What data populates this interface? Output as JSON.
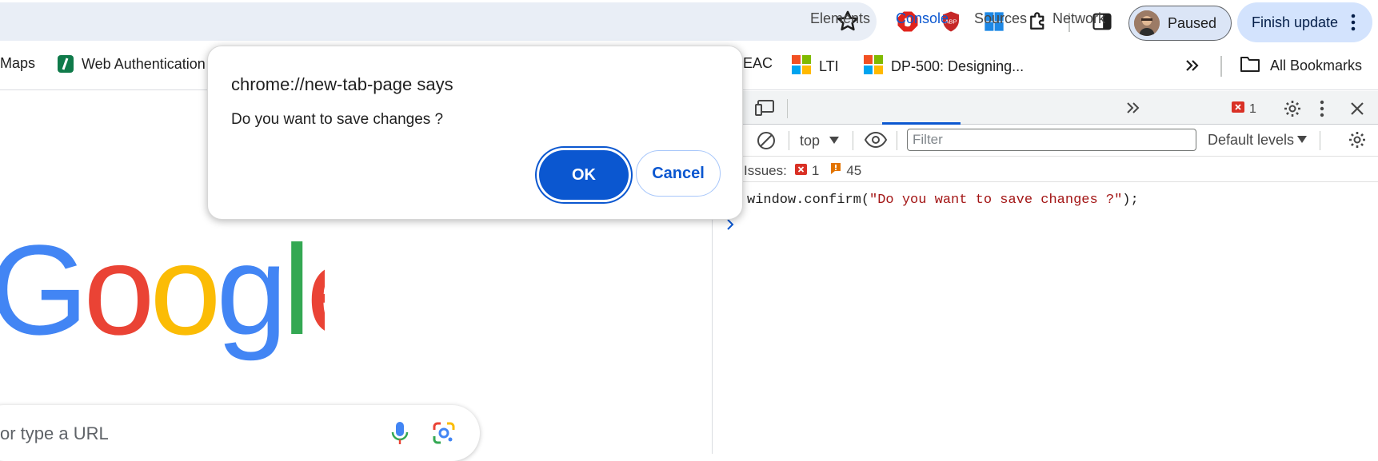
{
  "toolbar": {
    "profile_label": "Paused",
    "update_label": "Finish update"
  },
  "bookmarks": [
    {
      "label": "Maps"
    },
    {
      "label": "Web Authentication"
    },
    {
      "label": "EAC"
    },
    {
      "label": "LTI"
    },
    {
      "label": "DP-500: Designing..."
    }
  ],
  "all_bookmarks_label": "All Bookmarks",
  "page": {
    "logo_text": "Google",
    "search_placeholder": "or type a URL"
  },
  "dialog": {
    "title": "chrome://new-tab-page says",
    "message": "Do you want to save changes ?",
    "ok_label": "OK",
    "cancel_label": "Cancel"
  },
  "devtools": {
    "tabs": [
      "Elements",
      "Console",
      "Sources",
      "Network"
    ],
    "active_tab": "Console",
    "error_count": "1",
    "context": "top",
    "filter_placeholder": "Filter",
    "levels": "Default levels",
    "issues_label": "Issues:",
    "issues_errors": "1",
    "issues_warnings": "45",
    "console_code_prefix": "window.confirm(",
    "console_code_string": "\"Do you want to save changes ?\"",
    "console_code_suffix": ");"
  },
  "colors": {
    "accent": "#0b57d0",
    "error": "#d93025",
    "warning": "#e37400",
    "google_blue": "#4285f4",
    "google_red": "#ea4335",
    "google_yellow": "#fbbc05",
    "google_green": "#34a853"
  }
}
